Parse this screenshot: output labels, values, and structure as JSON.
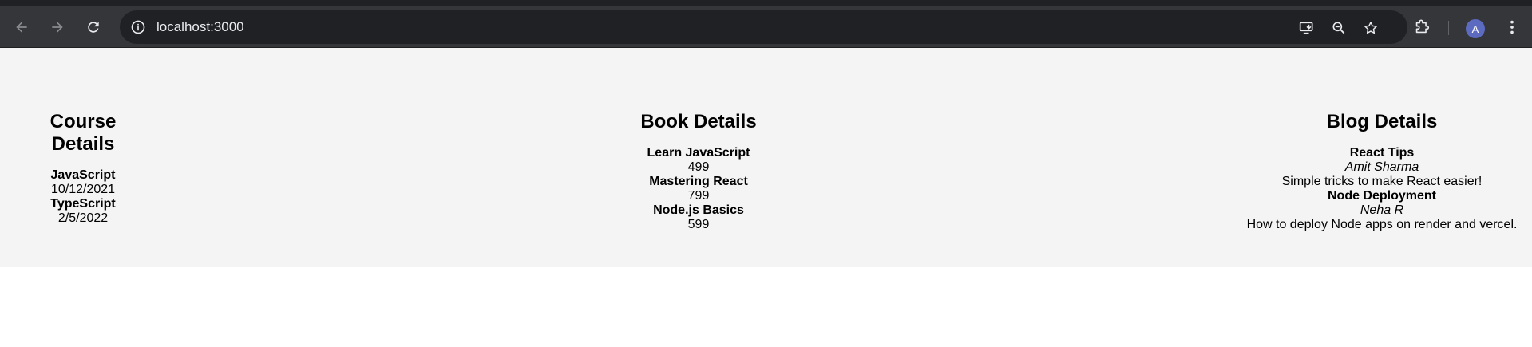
{
  "browser": {
    "url": "localhost:3000",
    "avatar_letter": "A"
  },
  "courses": {
    "heading": "Course Details",
    "items": [
      {
        "name": "JavaScript",
        "date": "10/12/2021"
      },
      {
        "name": "TypeScript",
        "date": "2/5/2022"
      }
    ]
  },
  "books": {
    "heading": "Book Details",
    "items": [
      {
        "name": "Learn JavaScript",
        "price": "499"
      },
      {
        "name": "Mastering React",
        "price": "799"
      },
      {
        "name": "Node.js Basics",
        "price": "599"
      }
    ]
  },
  "blogs": {
    "heading": "Blog Details",
    "items": [
      {
        "title": "React Tips",
        "author": "Amit Sharma",
        "description": "Simple tricks to make React easier!"
      },
      {
        "title": "Node Deployment",
        "author": "Neha R",
        "description": "How to deploy Node apps on render and vercel."
      }
    ]
  },
  "colors": {
    "chrome_bg": "#35363a",
    "omnibox_bg": "#202124",
    "page_bg": "#f4f4f4",
    "avatar_bg": "#5c6bc0"
  }
}
